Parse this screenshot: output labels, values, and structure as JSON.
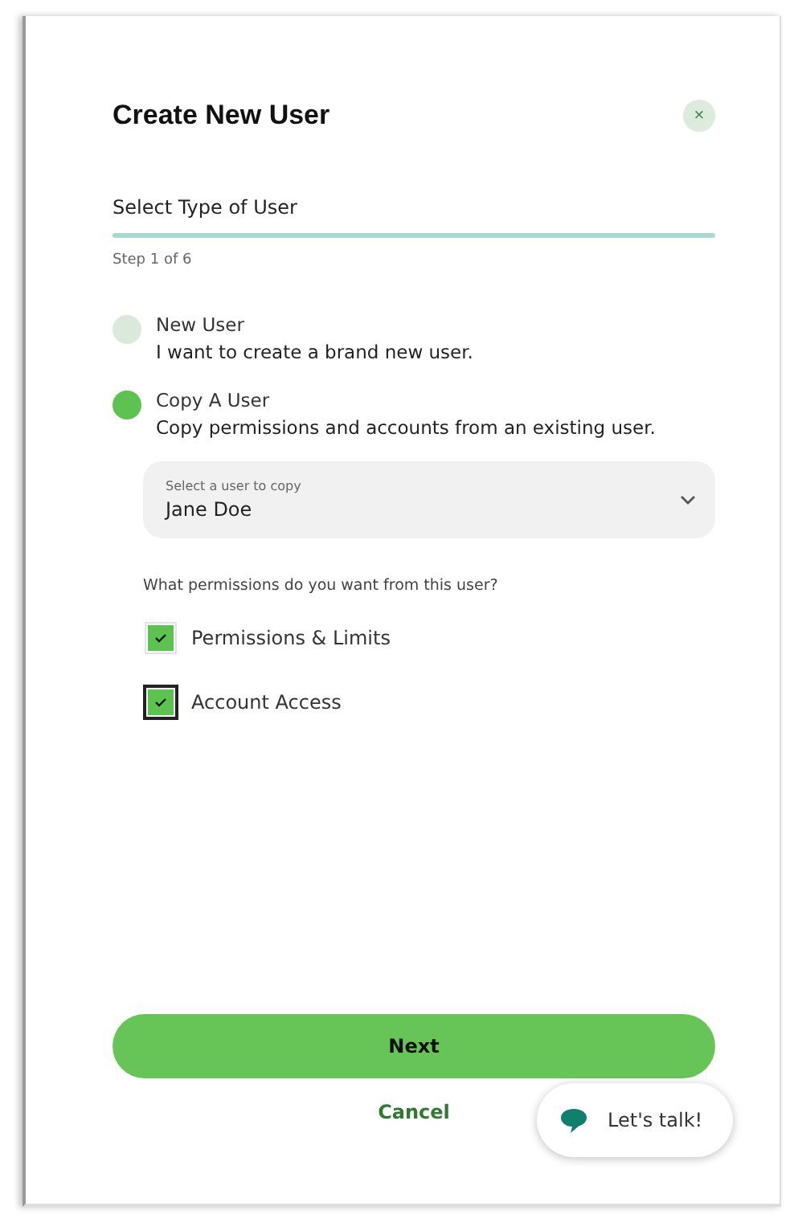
{
  "dialog": {
    "title": "Create New User",
    "close_label": "×"
  },
  "step": {
    "title": "Select Type of User",
    "counter": "Step 1 of 6"
  },
  "options": [
    {
      "label": "New User",
      "description": "I want to create a brand new user.",
      "selected": false
    },
    {
      "label": "Copy A User",
      "description": "Copy permissions and accounts from an existing user.",
      "selected": true
    }
  ],
  "user_select": {
    "label": "Select a user to copy",
    "value": "Jane Doe"
  },
  "permissions": {
    "question": "What permissions do you want from this user?",
    "items": [
      {
        "label": "Permissions & Limits",
        "checked": true,
        "focused": false
      },
      {
        "label": "Account Access",
        "checked": true,
        "focused": true
      }
    ]
  },
  "buttons": {
    "next": "Next",
    "cancel": "Cancel"
  },
  "chat": {
    "label": "Let's talk!"
  }
}
